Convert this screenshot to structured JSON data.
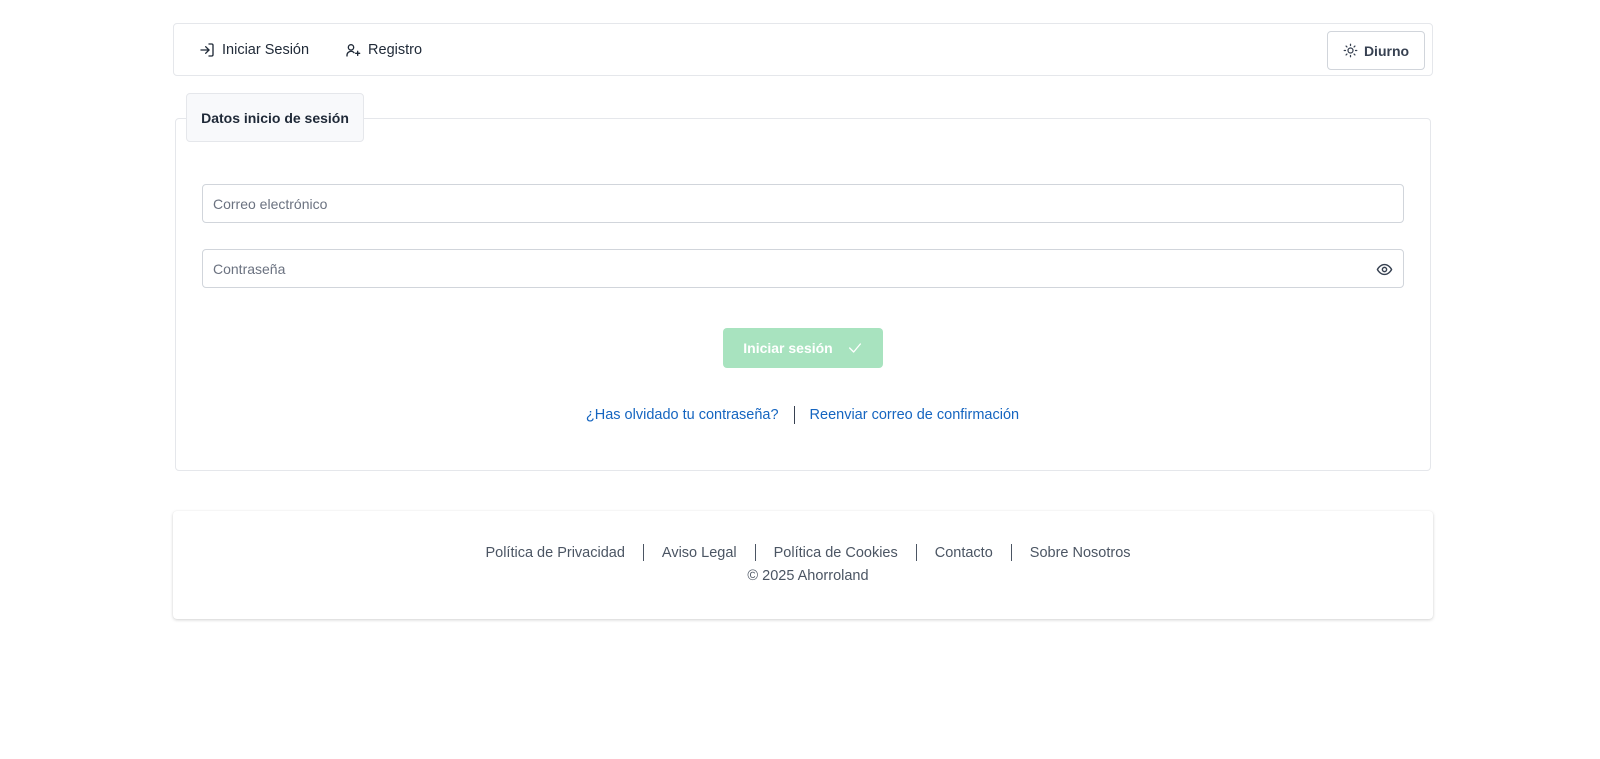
{
  "nav": {
    "login_label": "Iniciar Sesión",
    "register_label": "Registro",
    "theme_label": "Diurno"
  },
  "card": {
    "tab_title": "Datos inicio de sesión",
    "email_placeholder": "Correo electrónico",
    "email_value": "",
    "password_placeholder": "Contraseña",
    "password_value": "",
    "submit_label": "Iniciar sesión",
    "forgot_password_label": "¿Has olvidado tu contraseña?",
    "resend_confirmation_label": "Reenviar correo de confirmación"
  },
  "footer": {
    "links": [
      "Política de Privacidad",
      "Aviso Legal",
      "Política de Cookies",
      "Contacto",
      "Sobre Nosotros"
    ],
    "copyright": "© 2025 Ahorroland"
  },
  "colors": {
    "primary_disabled": "#a8e3bf",
    "link": "#1565c0"
  },
  "icons": {
    "login": "login-arrow-icon",
    "register": "user-plus-icon",
    "theme": "sun-icon",
    "password_toggle": "eye-icon",
    "submit": "check-icon"
  }
}
